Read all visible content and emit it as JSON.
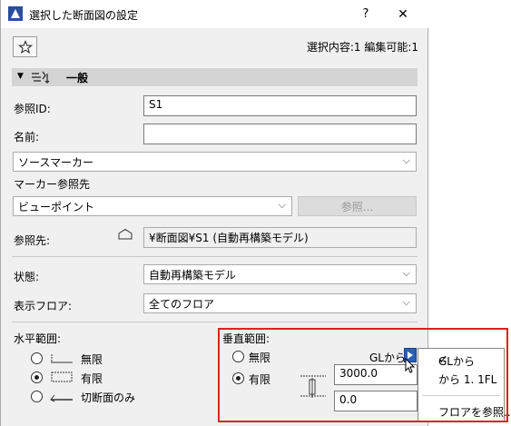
{
  "window": {
    "title": "選択した断面図の設定",
    "help_label": "?",
    "close_label": "✕"
  },
  "toolbar": {
    "selection_info": "選択内容:1 編集可能:1"
  },
  "panel": {
    "header_label": "一般"
  },
  "general": {
    "ref_id_label": "参照ID:",
    "ref_id_value": "S1",
    "name_label": "名前:",
    "name_value": "",
    "marker_type": "ソースマーカー",
    "marker_ref_label": "マーカー参照先",
    "marker_ref_value": "ビューポイント",
    "browse_label": "参照...",
    "ref_to_label": "参照先:",
    "ref_to_value": "¥断面図¥S1 (自動再構築モデル)",
    "status_label": "状態:",
    "status_value": "自動再構築モデル",
    "display_floor_label": "表示フロア:",
    "display_floor_value": "全てのフロア"
  },
  "horizontal_range": {
    "label": "水平範囲:",
    "options": [
      "無限",
      "有限",
      "切断面のみ"
    ],
    "selected": "有限"
  },
  "vertical_range": {
    "label": "垂直範囲:",
    "options": [
      "無限",
      "有限"
    ],
    "selected": "有限",
    "reference_label": "GLから",
    "top_value": "3000.0",
    "bottom_value": "0.0"
  },
  "popup_menu": {
    "items": [
      "GLから",
      "から 1. 1FL",
      "フロアを参照..."
    ],
    "checked": "GLから"
  },
  "colors": {
    "highlight": "#e02020",
    "panel_header": "#d4d4d4",
    "window_bg": "#f0f0f0"
  }
}
